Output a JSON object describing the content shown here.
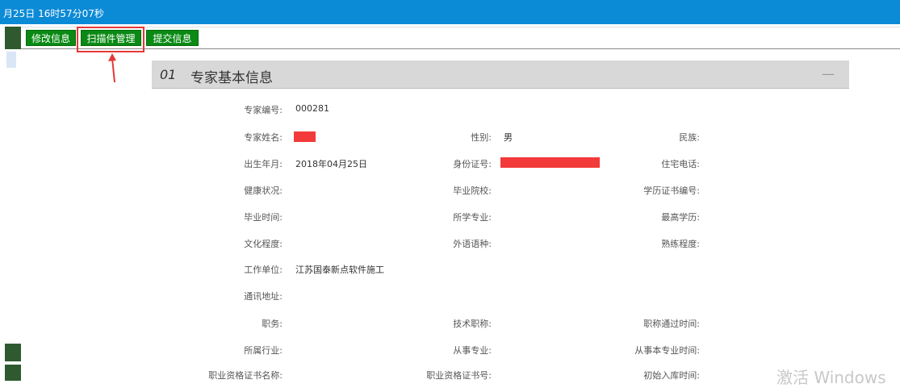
{
  "topbar": {
    "clock": "月25日 16时57分07秒"
  },
  "toolbar": {
    "edit_label": "修改信息",
    "scan_label": "扫描件管理",
    "submit_label": "提交信息"
  },
  "section": {
    "number": "01",
    "title": "专家基本信息",
    "collapse_symbol": "—"
  },
  "fields": {
    "expert_id": {
      "label": "专家编号:",
      "value": "000281"
    },
    "name": {
      "label": "专家姓名:"
    },
    "gender": {
      "label": "性别:",
      "value": "男"
    },
    "ethnicity": {
      "label": "民族:"
    },
    "birth": {
      "label": "出生年月:",
      "value": "2018年04月25日"
    },
    "id_card": {
      "label": "身份证号:"
    },
    "home_phone": {
      "label": "住宅电话:"
    },
    "health": {
      "label": "健康状况:"
    },
    "school": {
      "label": "毕业院校:"
    },
    "degree_cert": {
      "label": "学历证书编号:"
    },
    "grad_time": {
      "label": "毕业时间:"
    },
    "major": {
      "label": "所学专业:"
    },
    "top_edu": {
      "label": "最高学历:"
    },
    "culture": {
      "label": "文化程度:"
    },
    "foreign_lang": {
      "label": "外语语种:"
    },
    "proficiency": {
      "label": "熟练程度:"
    },
    "work_unit": {
      "label": "工作单位:",
      "value": "江苏国泰新点软件施工"
    },
    "address": {
      "label": "通讯地址:"
    },
    "duty": {
      "label": "职务:"
    },
    "tech_title": {
      "label": "技术职称:"
    },
    "title_time": {
      "label": "职称通过时间:"
    },
    "industry": {
      "label": "所属行业:"
    },
    "engaged_major": {
      "label": "从事专业:"
    },
    "engaged_time": {
      "label": "从事本专业时间:"
    },
    "cert_name": {
      "label": "职业资格证书名称:"
    },
    "cert_no": {
      "label": "职业资格证书号:"
    },
    "first_entry": {
      "label": "初始入库时间:"
    }
  },
  "watermark": "激活 Windows",
  "colors": {
    "topbar": "#0b8ad6",
    "button": "#0a8a14",
    "highlight": "#e53935",
    "redaction": "#f23a3a"
  }
}
